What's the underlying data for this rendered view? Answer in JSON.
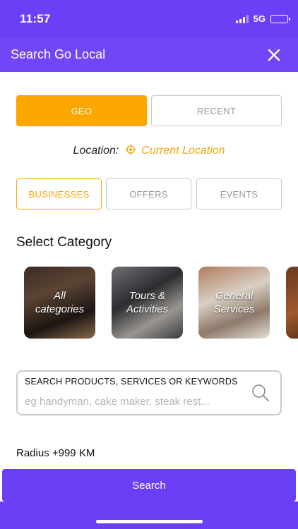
{
  "status_bar": {
    "time": "11:57",
    "network": "5G"
  },
  "header": {
    "title": "Search Go Local"
  },
  "mode_toggle": {
    "geo_label": "GEO",
    "recent_label": "RECENT"
  },
  "location": {
    "label": "Location:",
    "value": "Current Location"
  },
  "tabs": {
    "businesses": "BUSINESSES",
    "offers": "OFFERS",
    "events": "EVENTS"
  },
  "category_section": {
    "title": "Select Category",
    "items": [
      {
        "label": "All categories"
      },
      {
        "label": "Tours & Activities"
      },
      {
        "label": "General Services"
      },
      {
        "label": ""
      }
    ]
  },
  "search": {
    "label": "SEARCH PRODUCTS, SERVICES OR KEYWORDS",
    "placeholder": "eg handyman, cake maker, steak rest..."
  },
  "radius": {
    "text": "Radius +999 KM"
  },
  "search_button": {
    "label": "Search"
  },
  "colors": {
    "primary": "#6a3ff6",
    "accent": "#fba700",
    "location": "#f2a410"
  }
}
